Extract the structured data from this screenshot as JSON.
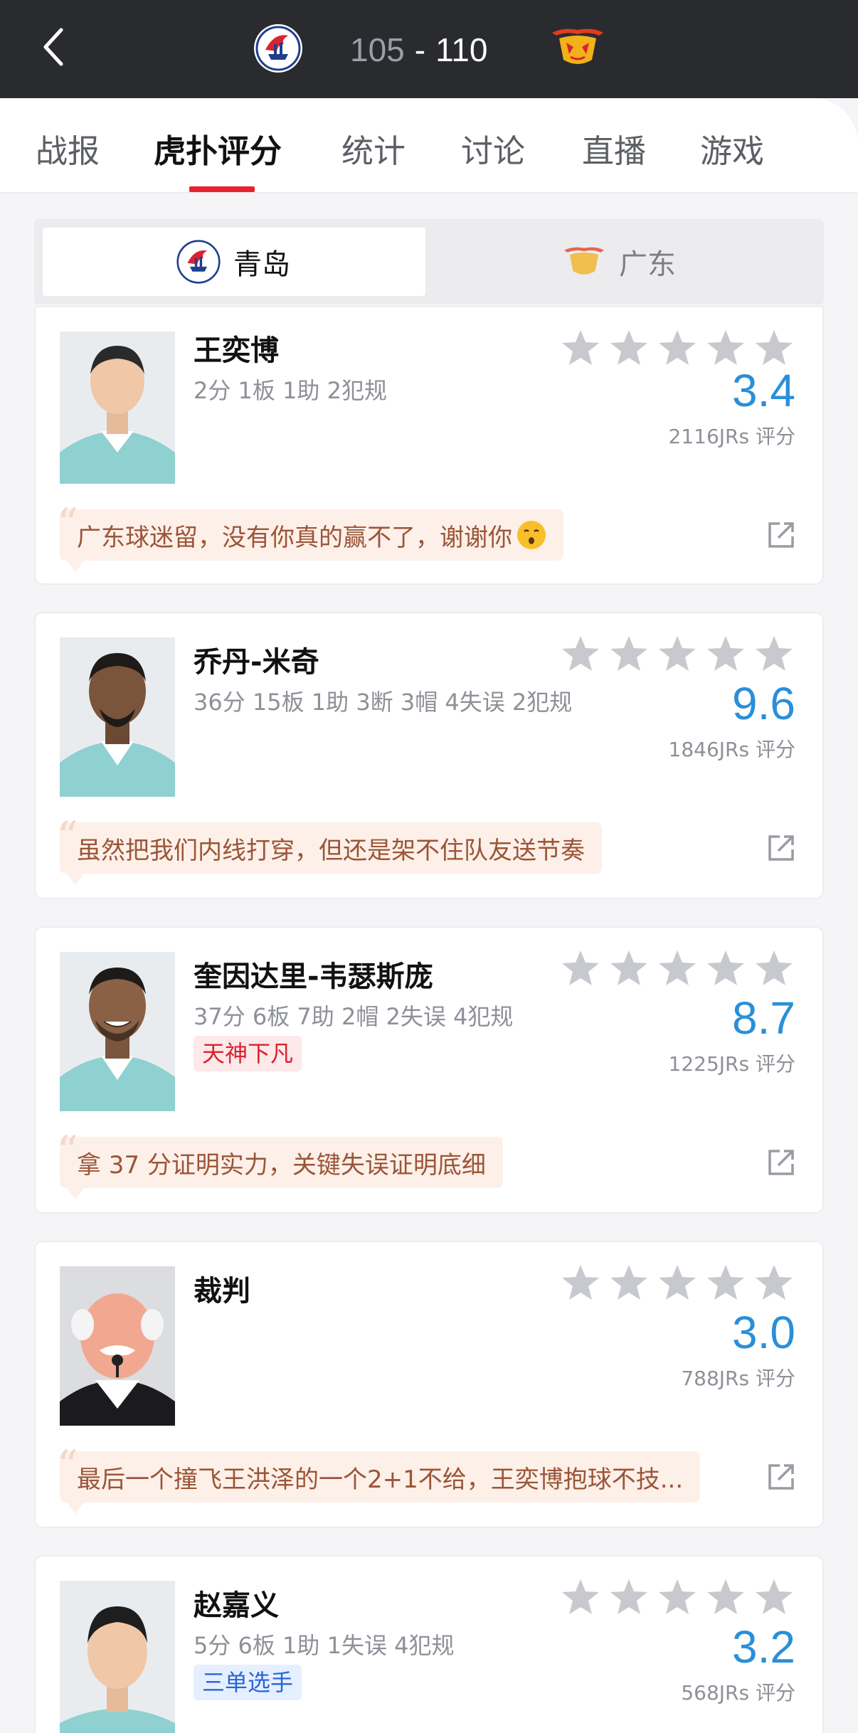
{
  "header": {
    "score_home": "105",
    "score_sep": "-",
    "score_away": "110",
    "home_logo": "qingdao-eagle-logo",
    "away_logo": "guangdong-tigers-logo"
  },
  "tabs": [
    {
      "label": "战报"
    },
    {
      "label": "虎扑评分"
    },
    {
      "label": "统计"
    },
    {
      "label": "讨论"
    },
    {
      "label": "直播"
    },
    {
      "label": "游戏"
    }
  ],
  "team_switch": {
    "home": "青岛",
    "away": "广东"
  },
  "players": [
    {
      "name": "王奕博",
      "stats": "2分 1板 1助 2犯规",
      "rating": "3.4",
      "jrs": "2116JRs 评分",
      "comment": "广东球迷留，没有你真的赢不了，谢谢你",
      "comment_emoji": "kissing-face-emoji"
    },
    {
      "name": "乔丹-米奇",
      "stats": "36分 15板 1助 3断 3帽 4失误 2犯规",
      "rating": "9.6",
      "jrs": "1846JRs 评分",
      "comment": "虽然把我们内线打穿，但还是架不住队友送节奏"
    },
    {
      "name": "奎因达里-韦瑟斯庞",
      "stats": "37分 6板 7助 2帽 2失误 4犯规",
      "tag": "天神下凡",
      "rating": "8.7",
      "jrs": "1225JRs 评分",
      "comment": "拿 37 分证明实力，关键失误证明底细"
    },
    {
      "name": "裁判",
      "stats": "",
      "rating": "3.0",
      "jrs": "788JRs 评分",
      "comment": "最后一个撞飞王洪泽的一个2+1不给，王奕博抱球不技..."
    },
    {
      "name": "赵嘉义",
      "stats": "5分 6板 1助 1失误 4犯规",
      "tag": "三单选手",
      "rating": "3.2",
      "jrs": "568JRs 评分"
    }
  ],
  "colors": {
    "header_bg": "#2a2b2f",
    "accent_red": "#e8212f",
    "rating_blue": "#2a8fd8",
    "comment_bg": "#fdf0e8",
    "comment_text": "#9b5538"
  }
}
